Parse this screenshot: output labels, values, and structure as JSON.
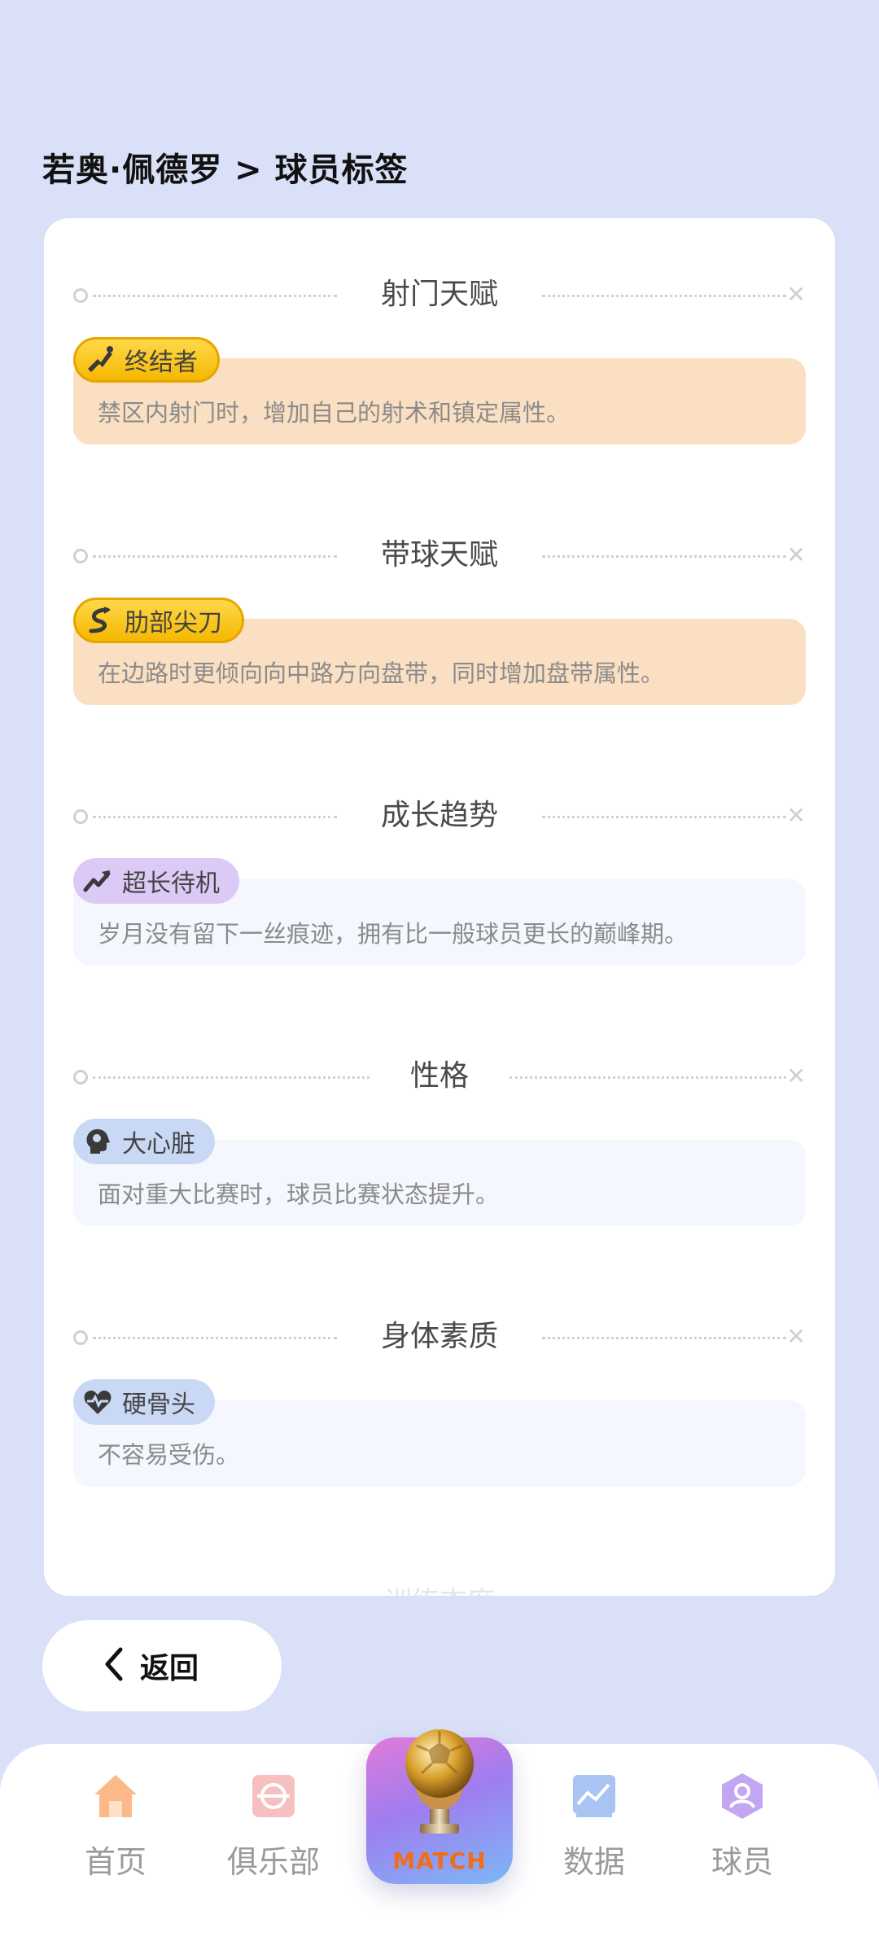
{
  "header": {
    "title": "若奥·佩德罗 > 球员标签"
  },
  "sections": [
    {
      "title": "射门天赋",
      "tag": "终结者",
      "desc": "禁区内射门时，增加自己的射术和镇定属性。",
      "icon": "shooting-boot-icon"
    },
    {
      "title": "带球天赋",
      "tag": "肋部尖刀",
      "desc": "在边路时更倾向向中路方向盘带，同时增加盘带属性。",
      "icon": "dribble-curve-icon"
    },
    {
      "title": "成长趋势",
      "tag": "超长待机",
      "desc": "岁月没有留下一丝痕迹，拥有比一般球员更长的巅峰期。",
      "icon": "trend-up-icon"
    },
    {
      "title": "性格",
      "tag": "大心脏",
      "desc": "面对重大比赛时，球员比赛状态提升。",
      "icon": "head-brain-icon"
    },
    {
      "title": "身体素质",
      "tag": "硬骨头",
      "desc": "不容易受伤。",
      "icon": "heart-pulse-icon"
    }
  ],
  "next_section_hint": "训练态度",
  "back_button": {
    "label": "返回"
  },
  "tabbar": {
    "items": [
      {
        "label": "首页",
        "icon": "home-icon"
      },
      {
        "label": "俱乐部",
        "icon": "club-icon"
      },
      {
        "label": "数据",
        "icon": "chart-icon"
      },
      {
        "label": "球员",
        "icon": "player-icon"
      }
    ],
    "center": {
      "label": "MATCH",
      "icon": "trophy-ball-icon"
    }
  },
  "colors": {
    "background": "#d9e0f7",
    "gold_badge": "#f5b800",
    "orange_box": "#fadfc2",
    "purple_badge": "#dcc9f5",
    "blue_badge": "#c9d8f4",
    "match_text": "#f26d16"
  }
}
